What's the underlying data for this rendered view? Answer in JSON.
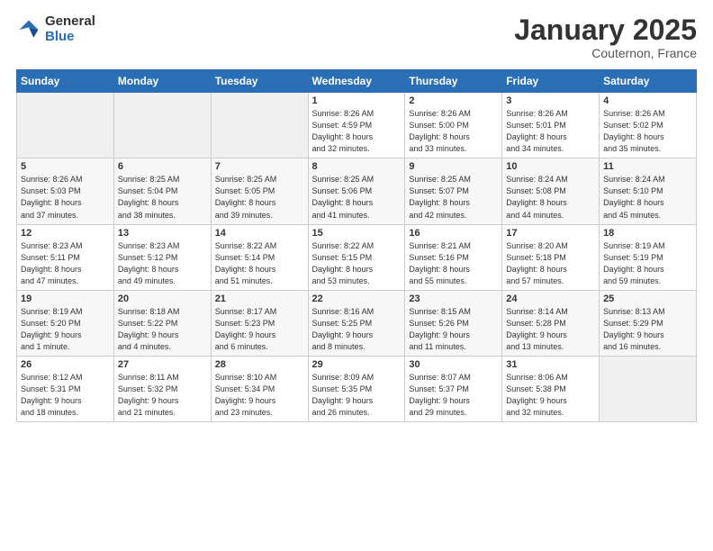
{
  "logo": {
    "general": "General",
    "blue": "Blue"
  },
  "header": {
    "month": "January 2025",
    "location": "Couternon, France"
  },
  "days_of_week": [
    "Sunday",
    "Monday",
    "Tuesday",
    "Wednesday",
    "Thursday",
    "Friday",
    "Saturday"
  ],
  "weeks": [
    [
      {
        "day": "",
        "info": ""
      },
      {
        "day": "",
        "info": ""
      },
      {
        "day": "",
        "info": ""
      },
      {
        "day": "1",
        "info": "Sunrise: 8:26 AM\nSunset: 4:59 PM\nDaylight: 8 hours\nand 32 minutes."
      },
      {
        "day": "2",
        "info": "Sunrise: 8:26 AM\nSunset: 5:00 PM\nDaylight: 8 hours\nand 33 minutes."
      },
      {
        "day": "3",
        "info": "Sunrise: 8:26 AM\nSunset: 5:01 PM\nDaylight: 8 hours\nand 34 minutes."
      },
      {
        "day": "4",
        "info": "Sunrise: 8:26 AM\nSunset: 5:02 PM\nDaylight: 8 hours\nand 35 minutes."
      }
    ],
    [
      {
        "day": "5",
        "info": "Sunrise: 8:26 AM\nSunset: 5:03 PM\nDaylight: 8 hours\nand 37 minutes."
      },
      {
        "day": "6",
        "info": "Sunrise: 8:25 AM\nSunset: 5:04 PM\nDaylight: 8 hours\nand 38 minutes."
      },
      {
        "day": "7",
        "info": "Sunrise: 8:25 AM\nSunset: 5:05 PM\nDaylight: 8 hours\nand 39 minutes."
      },
      {
        "day": "8",
        "info": "Sunrise: 8:25 AM\nSunset: 5:06 PM\nDaylight: 8 hours\nand 41 minutes."
      },
      {
        "day": "9",
        "info": "Sunrise: 8:25 AM\nSunset: 5:07 PM\nDaylight: 8 hours\nand 42 minutes."
      },
      {
        "day": "10",
        "info": "Sunrise: 8:24 AM\nSunset: 5:08 PM\nDaylight: 8 hours\nand 44 minutes."
      },
      {
        "day": "11",
        "info": "Sunrise: 8:24 AM\nSunset: 5:10 PM\nDaylight: 8 hours\nand 45 minutes."
      }
    ],
    [
      {
        "day": "12",
        "info": "Sunrise: 8:23 AM\nSunset: 5:11 PM\nDaylight: 8 hours\nand 47 minutes."
      },
      {
        "day": "13",
        "info": "Sunrise: 8:23 AM\nSunset: 5:12 PM\nDaylight: 8 hours\nand 49 minutes."
      },
      {
        "day": "14",
        "info": "Sunrise: 8:22 AM\nSunset: 5:14 PM\nDaylight: 8 hours\nand 51 minutes."
      },
      {
        "day": "15",
        "info": "Sunrise: 8:22 AM\nSunset: 5:15 PM\nDaylight: 8 hours\nand 53 minutes."
      },
      {
        "day": "16",
        "info": "Sunrise: 8:21 AM\nSunset: 5:16 PM\nDaylight: 8 hours\nand 55 minutes."
      },
      {
        "day": "17",
        "info": "Sunrise: 8:20 AM\nSunset: 5:18 PM\nDaylight: 8 hours\nand 57 minutes."
      },
      {
        "day": "18",
        "info": "Sunrise: 8:19 AM\nSunset: 5:19 PM\nDaylight: 8 hours\nand 59 minutes."
      }
    ],
    [
      {
        "day": "19",
        "info": "Sunrise: 8:19 AM\nSunset: 5:20 PM\nDaylight: 9 hours\nand 1 minute."
      },
      {
        "day": "20",
        "info": "Sunrise: 8:18 AM\nSunset: 5:22 PM\nDaylight: 9 hours\nand 4 minutes."
      },
      {
        "day": "21",
        "info": "Sunrise: 8:17 AM\nSunset: 5:23 PM\nDaylight: 9 hours\nand 6 minutes."
      },
      {
        "day": "22",
        "info": "Sunrise: 8:16 AM\nSunset: 5:25 PM\nDaylight: 9 hours\nand 8 minutes."
      },
      {
        "day": "23",
        "info": "Sunrise: 8:15 AM\nSunset: 5:26 PM\nDaylight: 9 hours\nand 11 minutes."
      },
      {
        "day": "24",
        "info": "Sunrise: 8:14 AM\nSunset: 5:28 PM\nDaylight: 9 hours\nand 13 minutes."
      },
      {
        "day": "25",
        "info": "Sunrise: 8:13 AM\nSunset: 5:29 PM\nDaylight: 9 hours\nand 16 minutes."
      }
    ],
    [
      {
        "day": "26",
        "info": "Sunrise: 8:12 AM\nSunset: 5:31 PM\nDaylight: 9 hours\nand 18 minutes."
      },
      {
        "day": "27",
        "info": "Sunrise: 8:11 AM\nSunset: 5:32 PM\nDaylight: 9 hours\nand 21 minutes."
      },
      {
        "day": "28",
        "info": "Sunrise: 8:10 AM\nSunset: 5:34 PM\nDaylight: 9 hours\nand 23 minutes."
      },
      {
        "day": "29",
        "info": "Sunrise: 8:09 AM\nSunset: 5:35 PM\nDaylight: 9 hours\nand 26 minutes."
      },
      {
        "day": "30",
        "info": "Sunrise: 8:07 AM\nSunset: 5:37 PM\nDaylight: 9 hours\nand 29 minutes."
      },
      {
        "day": "31",
        "info": "Sunrise: 8:06 AM\nSunset: 5:38 PM\nDaylight: 9 hours\nand 32 minutes."
      },
      {
        "day": "",
        "info": ""
      }
    ]
  ]
}
